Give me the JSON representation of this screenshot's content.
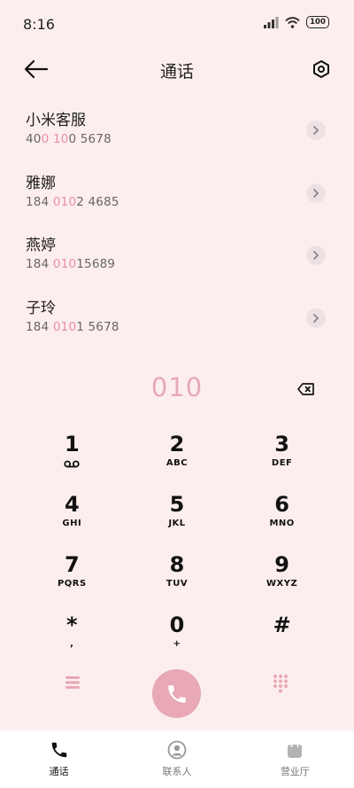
{
  "status_bar": {
    "time": "8:16",
    "battery": "100"
  },
  "header": {
    "title": "通话"
  },
  "contacts": [
    {
      "name": "小米客服",
      "num_pre": "40",
      "num_hl": "0 10",
      "num_post": "0 5678"
    },
    {
      "name": "雅娜",
      "num_pre": "184 ",
      "num_hl": "010",
      "num_post": "2 4685"
    },
    {
      "name": "燕婷",
      "num_pre": "184 ",
      "num_hl": "010",
      "num_post": "15689"
    },
    {
      "name": "子玲",
      "num_pre": "184 ",
      "num_hl": "010",
      "num_post": "1 5678"
    }
  ],
  "dialer": {
    "typed_number": "010"
  },
  "keypad": [
    {
      "digit": "1",
      "letters": ""
    },
    {
      "digit": "2",
      "letters": "ABC"
    },
    {
      "digit": "3",
      "letters": "DEF"
    },
    {
      "digit": "4",
      "letters": "GHI"
    },
    {
      "digit": "5",
      "letters": "JKL"
    },
    {
      "digit": "6",
      "letters": "MNO"
    },
    {
      "digit": "7",
      "letters": "PQRS"
    },
    {
      "digit": "8",
      "letters": "TUV"
    },
    {
      "digit": "9",
      "letters": "WXYZ"
    },
    {
      "digit": "*",
      "letters": ","
    },
    {
      "digit": "0",
      "letters": "+"
    },
    {
      "digit": "#",
      "letters": ""
    }
  ],
  "nav": [
    {
      "label": "通话"
    },
    {
      "label": "联系人"
    },
    {
      "label": "营业厅"
    }
  ],
  "colors": {
    "accent": "#e8a8b5",
    "background": "#fdeeee",
    "highlight": "#e58fa6"
  }
}
